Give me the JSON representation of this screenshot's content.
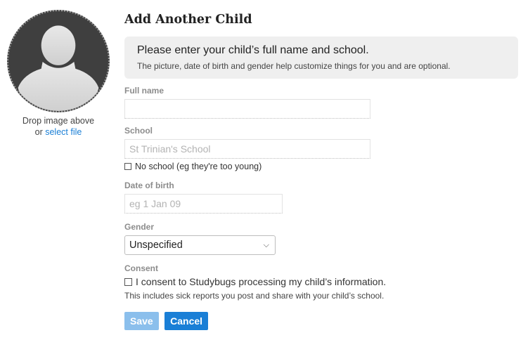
{
  "avatar": {
    "icon": "person-silhouette-icon",
    "drop_text": "Drop image above",
    "or_text": "or ",
    "select_file": "select file"
  },
  "form": {
    "title": "Add Another Child",
    "info": {
      "main": "Please enter your child’s full name and school.",
      "sub": "The picture, date of birth and gender help customize things for you and are optional."
    },
    "full_name": {
      "label": "Full name",
      "value": "",
      "placeholder": ""
    },
    "school": {
      "label": "School",
      "value": "",
      "placeholder": "St Trinian's School",
      "no_school_label": "No school (eg they're too young)",
      "no_school_checked": false
    },
    "dob": {
      "label": "Date of birth",
      "value": "",
      "placeholder": "eg 1 Jan 09"
    },
    "gender": {
      "label": "Gender",
      "selected": "Unspecified"
    },
    "consent": {
      "label": "Consent",
      "checkbox_label": "I consent to Studybugs processing my child’s information.",
      "checked": false,
      "note": "This includes sick reports you post and share with your child’s school."
    },
    "buttons": {
      "save": "Save",
      "cancel": "Cancel"
    }
  },
  "colors": {
    "link": "#1a7fd6",
    "save_button": "#8bbfec",
    "cancel_button": "#1a7fd6",
    "info_background": "#efefef"
  }
}
